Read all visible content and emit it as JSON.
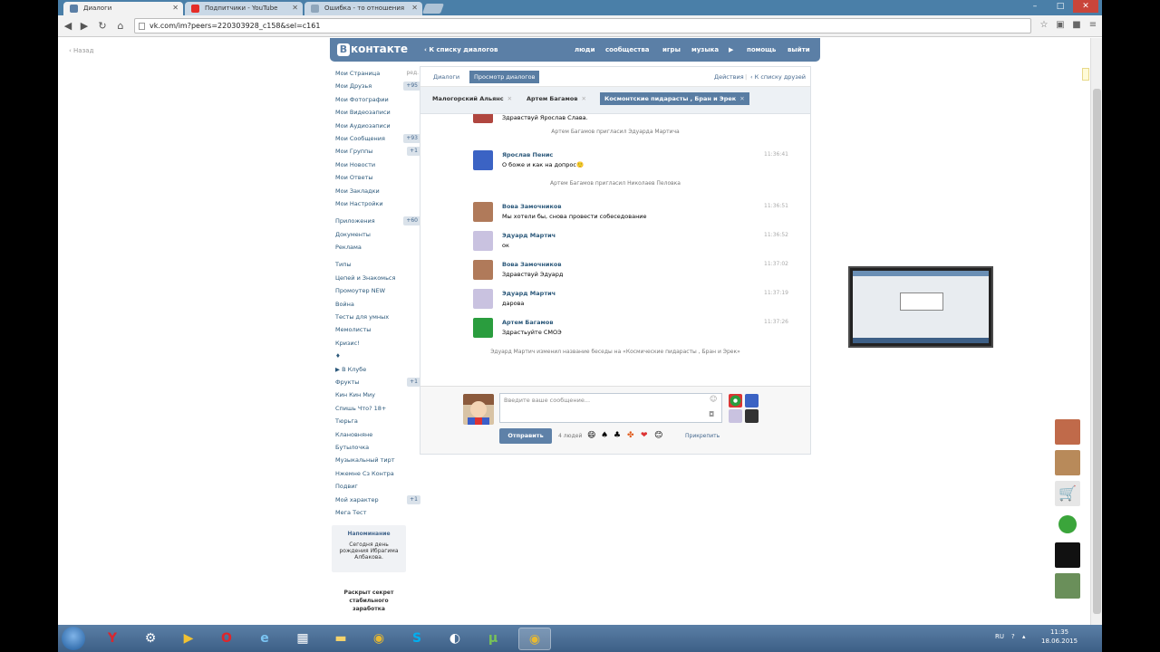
{
  "browser": {
    "tabs": [
      {
        "label": "Диалоги",
        "active": true,
        "icon": "vk-icon",
        "color": "#5b7fa6"
      },
      {
        "label": "Подпитчики - YouTube",
        "active": false,
        "icon": "youtube-icon",
        "color": "#e52d27"
      },
      {
        "label": "Ошибка - то отношения",
        "active": false,
        "icon": "page-icon",
        "color": "#8fa6bb"
      }
    ],
    "url": "vk.com/im?peers=220303928_c158&sel=c161",
    "window_controls": [
      "–",
      "□",
      "✕"
    ]
  },
  "page": {
    "back_link": "Назад"
  },
  "vk": {
    "logo": "контакте",
    "logo_badge": "В",
    "header_back": "К списку диалогов",
    "nav": [
      "люди",
      "сообщества",
      "игры",
      "музыка",
      "помощь",
      "выйти"
    ]
  },
  "left_menu": [
    {
      "label": "Мои Страница",
      "count": "",
      "edit": "ред."
    },
    {
      "label": "Мои Друзья",
      "count": "+95",
      "edit": ""
    },
    {
      "label": "Мои Фотографии",
      "count": "",
      "edit": ""
    },
    {
      "label": "Мои Видеозаписи",
      "count": "",
      "edit": ""
    },
    {
      "label": "Мои Аудиозаписи",
      "count": "",
      "edit": ""
    },
    {
      "label": "Мои Сообщения",
      "count": "+93",
      "edit": ""
    },
    {
      "label": "Мои Группы",
      "count": "+1",
      "edit": ""
    },
    {
      "label": "Мои Новости",
      "count": "",
      "edit": ""
    },
    {
      "label": "Мои Ответы",
      "count": "",
      "edit": ""
    },
    {
      "label": "Мои Закладки",
      "count": "",
      "edit": ""
    },
    {
      "label": "Мои Настройки",
      "count": "",
      "edit": ""
    },
    {
      "label": "Приложения",
      "count": "+60",
      "edit": "",
      "gap": true
    },
    {
      "label": "Документы",
      "count": "",
      "edit": ""
    },
    {
      "label": "Реклама",
      "count": "",
      "edit": ""
    },
    {
      "label": "Типы",
      "count": "",
      "edit": "",
      "gap": true
    },
    {
      "label": "Цепей и Знакомься",
      "count": "",
      "edit": ""
    },
    {
      "label": "Промоутер NEW",
      "count": "",
      "edit": ""
    },
    {
      "label": "Война",
      "count": "",
      "edit": ""
    },
    {
      "label": "Тесты для умных",
      "count": "",
      "edit": ""
    },
    {
      "label": "Мемолисты",
      "count": "",
      "edit": ""
    },
    {
      "label": "Кризис!",
      "count": "",
      "edit": ""
    },
    {
      "label": "♦",
      "count": "",
      "edit": ""
    },
    {
      "label": "▶ В Клубе",
      "count": "",
      "edit": ""
    },
    {
      "label": "Фрукты",
      "count": "+1",
      "edit": ""
    },
    {
      "label": "Кин Кин Миу",
      "count": "",
      "edit": ""
    },
    {
      "label": "Спишь Что? 18+",
      "count": "",
      "edit": ""
    },
    {
      "label": "Тюрьга",
      "count": "",
      "edit": ""
    },
    {
      "label": "Клановняне",
      "count": "",
      "edit": ""
    },
    {
      "label": "Бутылочка",
      "count": "",
      "edit": ""
    },
    {
      "label": "Музыкальный тирт",
      "count": "",
      "edit": ""
    },
    {
      "label": "Нжемне Сз Контра",
      "count": "",
      "edit": ""
    },
    {
      "label": "Подвиг",
      "count": "",
      "edit": ""
    },
    {
      "label": "Мой характер",
      "count": "+1",
      "edit": ""
    },
    {
      "label": "Мега Тест",
      "count": "",
      "edit": ""
    }
  ],
  "reminder": {
    "title": "Напоминание",
    "line1": "Сегодня день",
    "line2": "рождения Ибрагима",
    "line3": "Албакова."
  },
  "promo": {
    "line1": "Раскрыт секрет",
    "line2": "стабильного",
    "line3": "заработка"
  },
  "dialog": {
    "subtabs": [
      "Диалоги",
      "Просмотр диалогов"
    ],
    "actions": "Действия",
    "back_to_list": "К списку друзей",
    "chats": [
      {
        "label": "Малогорский Альянс",
        "active": false
      },
      {
        "label": "Артем Багамов",
        "active": false
      },
      {
        "label": "Космонтские пидарасты , Бран и Эрек",
        "active": true
      }
    ],
    "chip_close": "✕",
    "partial_text": "Здравствуй Ярослав Слава.",
    "messages": [
      {
        "type": "system",
        "text": "Артем Багамов пригласил Эдуарда Мартича"
      },
      {
        "type": "msg",
        "name": "Ярослав Пенис",
        "text": "О боже и как на допрос🙂",
        "time": "11:36:41",
        "avatar": "avatar-sonic",
        "avcolor": "#3b63c4"
      },
      {
        "type": "system",
        "text": "Артем Багамов пригласил Николаев Пеловка"
      },
      {
        "type": "msg",
        "name": "Вова Замочников",
        "text": "Мы хотели бы, снова провести собеседование",
        "time": "11:36:51",
        "avatar": "avatar-girl",
        "avcolor": "#b07a5a"
      },
      {
        "type": "msg",
        "name": "Эдуард Мартич",
        "text": "ок",
        "time": "11:36:52",
        "avatar": "avatar-anime",
        "avcolor": "#c9c2e0"
      },
      {
        "type": "msg",
        "name": "Вова Замочников",
        "text": "Здравствуй Эдуард",
        "time": "11:37:02",
        "avatar": "avatar-girl",
        "avcolor": "#b07a5a"
      },
      {
        "type": "msg",
        "name": "Эдуард Мартич",
        "text": "дарова",
        "time": "11:37:19",
        "avatar": "avatar-anime",
        "avcolor": "#c9c2e0"
      },
      {
        "type": "msg",
        "name": "Артем Багамов",
        "text": "Здрастьуйте СМОЭ",
        "time": "11:37:26",
        "avatar": "avatar-flag",
        "avcolor": "#2a9d3e"
      },
      {
        "type": "system",
        "text": "Эдуард Мартич изменил название беседы на «Космические пидарасты , Бран и Эрек»"
      }
    ],
    "compose": {
      "placeholder": "Введите ваше сообщение...",
      "send": "Отправить",
      "people": "4 людей",
      "attach": "Прикрепить",
      "emoji": [
        "😄",
        "♠",
        "♣",
        "✤",
        "❤",
        "😊"
      ]
    }
  },
  "colors": {
    "vk_blue": "#5b7fa6",
    "link": "#2b587a"
  },
  "taskbar": {
    "apps": [
      "windows-explorer-icon",
      "yandex-icon",
      "tools-icon",
      "media-icon",
      "opera-icon",
      "ie-icon",
      "games-icon",
      "folder-icon",
      "chrome-icon",
      "skype-icon",
      "steam-icon",
      "utorrent-icon",
      "chrome-active-icon"
    ],
    "lang": "RU",
    "time": "11:35",
    "date": "18.06.2015"
  }
}
